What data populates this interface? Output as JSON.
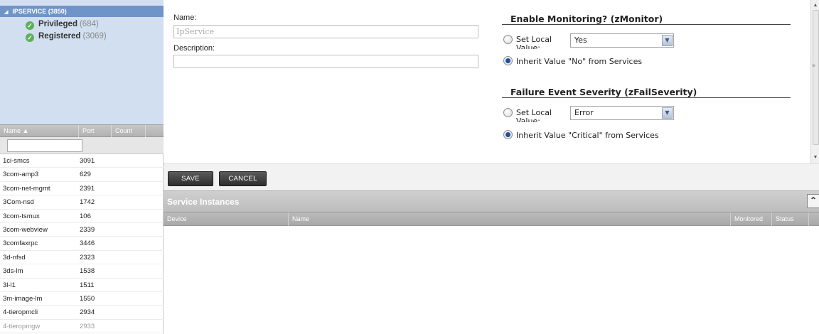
{
  "tree": {
    "root": {
      "label": "IPSERVICE (3850)"
    },
    "children": [
      {
        "label": "Privileged",
        "count": "(684)"
      },
      {
        "label": "Registered",
        "count": "(3069)"
      }
    ]
  },
  "list": {
    "columns": [
      "Name ▲",
      "Port",
      "Count"
    ],
    "filter_value": "",
    "rows": [
      {
        "name": "1ci-smcs",
        "port": "3091"
      },
      {
        "name": "3com-amp3",
        "port": "629"
      },
      {
        "name": "3com-net-mgmt",
        "port": "2391"
      },
      {
        "name": "3Com-nsd",
        "port": "1742"
      },
      {
        "name": "3com-tsmux",
        "port": "106"
      },
      {
        "name": "3com-webview",
        "port": "2339"
      },
      {
        "name": "3comfaxrpc",
        "port": "3446"
      },
      {
        "name": "3d-nfsd",
        "port": "2323"
      },
      {
        "name": "3ds-lm",
        "port": "1538"
      },
      {
        "name": "3l-l1",
        "port": "1511"
      },
      {
        "name": "3m-image-lm",
        "port": "1550"
      },
      {
        "name": "4-tieropmcli",
        "port": "2934"
      },
      {
        "name": "4-tieropmgw",
        "port": "2933"
      }
    ]
  },
  "form": {
    "name_label": "Name:",
    "name_value": "IpService",
    "description_label": "Description:",
    "description_value": ""
  },
  "monitoring": {
    "title": "Enable Monitoring? (zMonitor)",
    "set_local_label": "Set Local Value:",
    "select_value": "Yes",
    "inherit_label": "Inherit Value \"No\" from Services"
  },
  "severity": {
    "title": "Failure Event Severity (zFailSeverity)",
    "set_local_label": "Set Local Value:",
    "select_value": "Error",
    "inherit_label": "Inherit Value \"Critical\" from Services"
  },
  "buttons": {
    "save": "SAVE",
    "cancel": "CANCEL"
  },
  "instances": {
    "title": "Service Instances",
    "columns": [
      "Device",
      "Name",
      "Monitored",
      "Status"
    ]
  },
  "colors": {
    "tree_bg": "#d1dff0",
    "tree_selected": "#6f95c8",
    "check_green": "#5db05a",
    "button_dark": "#3a3a3a"
  }
}
